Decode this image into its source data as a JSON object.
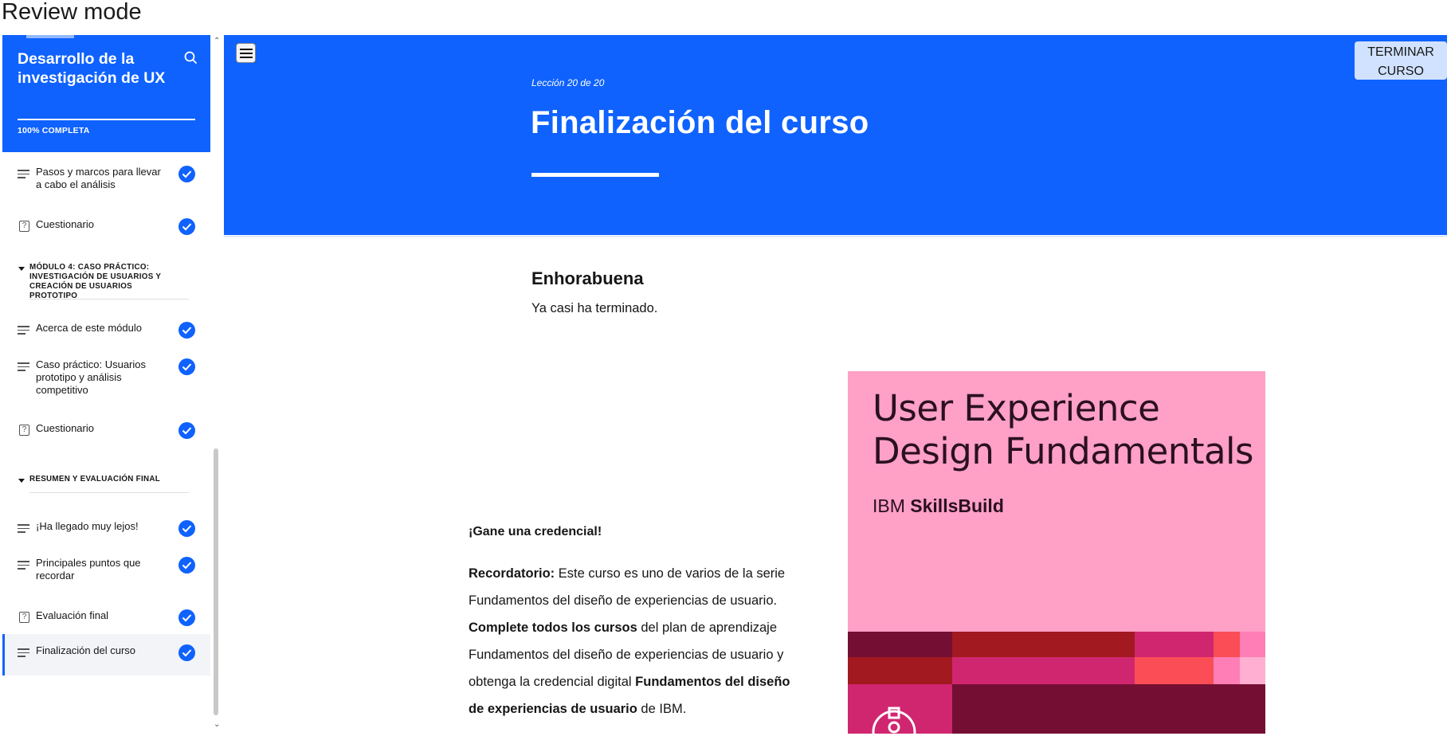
{
  "review_mode": "Review mode",
  "sidebar": {
    "course_title": "Desarrollo de la investigación de UX",
    "progress_label": "100% COMPLETA",
    "items": [
      {
        "type": "lesson",
        "label": "Pasos y marcos para llevar a cabo el análisis",
        "done": true
      },
      {
        "type": "quiz",
        "label": "Cuestionario",
        "done": true
      },
      {
        "type": "module",
        "label": "MÓDULO 4: CASO PRÁCTICO: INVESTIGACIÓN DE USUARIOS Y CREACIÓN DE USUARIOS PROTOTIPO"
      },
      {
        "type": "lesson",
        "label": "Acerca de este módulo",
        "done": true
      },
      {
        "type": "lesson",
        "label": "Caso práctico: Usuarios prototipo y análisis competitivo",
        "done": true
      },
      {
        "type": "quiz",
        "label": "Cuestionario",
        "done": true
      },
      {
        "type": "module",
        "label": "RESUMEN Y EVALUACIÓN FINAL"
      },
      {
        "type": "lesson",
        "label": "¡Ha llegado muy lejos!",
        "done": true
      },
      {
        "type": "lesson",
        "label": "Principales puntos que recordar",
        "done": true
      },
      {
        "type": "quiz",
        "label": "Evaluación final",
        "done": true
      },
      {
        "type": "lesson",
        "label": "Finalización del curso",
        "done": true,
        "active": true
      }
    ]
  },
  "header": {
    "lesson_counter": "Lección 20 de 20",
    "lesson_title": "Finalización del curso",
    "finish_button": "TERMINAR CURSO"
  },
  "content": {
    "heading": "Enhorabuena",
    "intro": "Ya casi ha terminado.",
    "credential_title": "¡Gane una credencial!",
    "credential_parts": {
      "reminder_bold": "Recordatorio:",
      "reminder_text": " Este curso es uno de varios de la serie Fundamentos del diseño de experiencias de usuario. ",
      "complete_bold": "Complete todos los cursos",
      "complete_text": " del plan de aprendizaje Fundamentos del diseño de experiencias de usuario y obtenga la credencial digital ",
      "credential_bold": "Fundamentos del diseño de experiencias de usuario",
      "end_text": " de IBM."
    }
  },
  "badge": {
    "title": "User Experience Design Fundamentals",
    "brand_prefix": "IBM ",
    "brand_bold": "SkillsBuild"
  },
  "colors": {
    "primary": "#0f62fe",
    "badge_pink": "#ffa0c6",
    "badge_maroon": "#750e33",
    "badge_red": "#a2191f",
    "badge_magenta": "#d02670",
    "badge_coral": "#fa4d56"
  }
}
